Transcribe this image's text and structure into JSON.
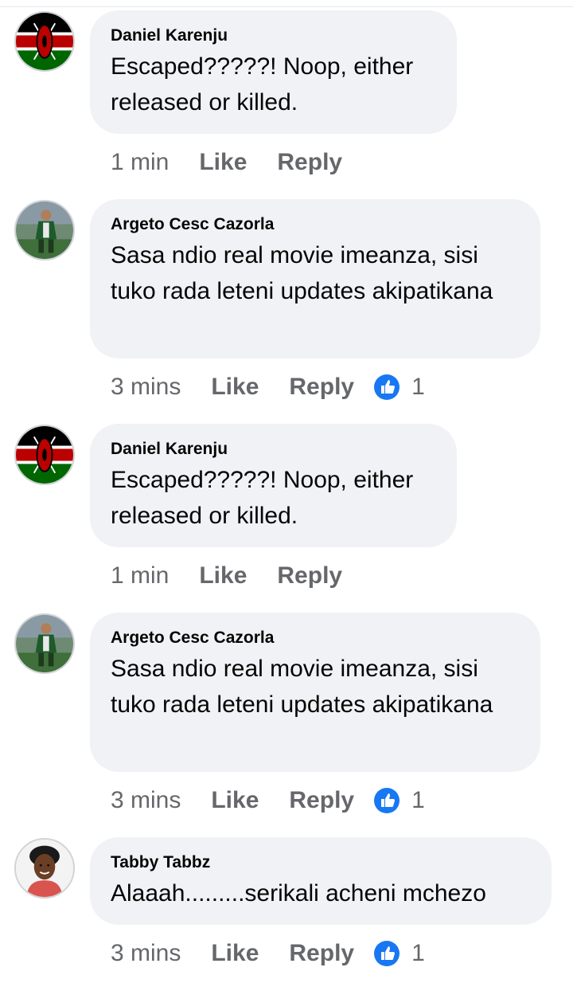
{
  "comments": [
    {
      "author": "Daniel Karenju",
      "text": "Escaped?????! Noop, either released or killed.",
      "time": "1 min",
      "like": "Like",
      "reply": "Reply",
      "reactions": null,
      "avatar": "kenya-flag-avatar"
    },
    {
      "author": "Argeto Cesc Cazorla",
      "text": "Sasa ndio real movie imeanza, sisi tuko rada leteni updates akipatikana",
      "time": "3 mins",
      "like": "Like",
      "reply": "Reply",
      "reactions": "1",
      "avatar": "football-player-avatar"
    },
    {
      "author": "Daniel Karenju",
      "text": "Escaped?????! Noop, either released or killed.",
      "time": "1 min",
      "like": "Like",
      "reply": "Reply",
      "reactions": null,
      "avatar": "kenya-flag-avatar"
    },
    {
      "author": "Argeto Cesc Cazorla",
      "text": "Sasa ndio real movie imeanza, sisi tuko rada leteni updates akipatikana",
      "time": "3 mins",
      "like": "Like",
      "reply": "Reply",
      "reactions": "1",
      "avatar": "football-player-avatar"
    },
    {
      "author": "Tabby Tabbz",
      "text": "Alaaah.........serikali acheni mchezo",
      "time": "3 mins",
      "like": "Like",
      "reply": "Reply",
      "reactions": "1",
      "avatar": "woman-avatar"
    }
  ],
  "colors": {
    "bubble": "#f0f2f5",
    "text": "#050505",
    "meta": "#65676b",
    "like_icon": "#1877f2"
  }
}
